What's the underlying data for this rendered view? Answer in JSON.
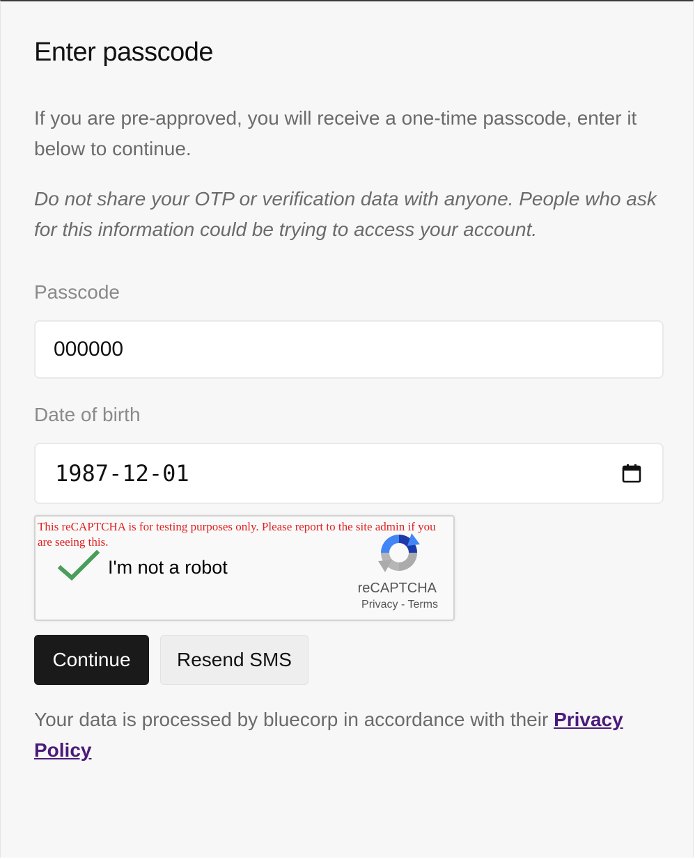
{
  "page": {
    "title": "Enter passcode",
    "intro": "If you are pre-approved, you will receive a one-time passcode, enter it below to continue.",
    "warning": "Do not share your OTP or verification data with anyone. People who ask for this information could be trying to access your account."
  },
  "form": {
    "passcode": {
      "label": "Passcode",
      "value": "000000"
    },
    "date_of_birth": {
      "label": "Date of birth",
      "value": "1987-12-01",
      "icon": "calendar-icon"
    }
  },
  "recaptcha": {
    "warning": "This reCAPTCHA is for testing purposes only. Please report to the site admin if you are seeing this.",
    "label": "I'm not a robot",
    "checked": true,
    "brand": "reCAPTCHA",
    "privacy_link": "Privacy",
    "separator": "-",
    "terms_link": "Terms",
    "check_color": "#4a9d5b"
  },
  "buttons": {
    "continue_label": "Continue",
    "resend_label": "Resend SMS"
  },
  "footer": {
    "text": "Your data is processed by bluecorp in accordance with their ",
    "link_label": "Privacy Policy",
    "link_color": "#4b1b7a"
  }
}
